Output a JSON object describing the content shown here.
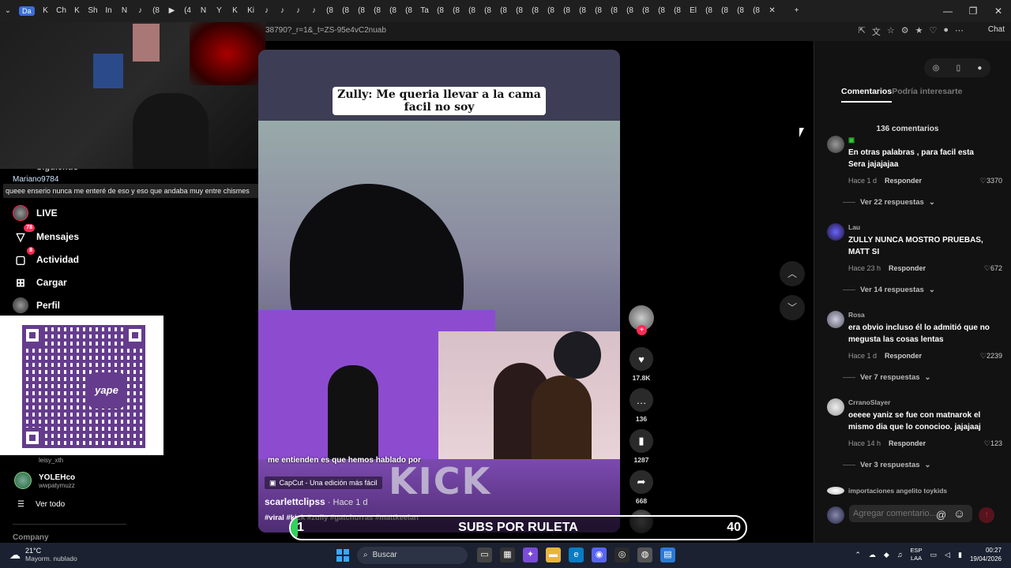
{
  "browser": {
    "active_tab_label": "Da",
    "tab_glyphs": [
      "K",
      "Ch",
      "K",
      "Sh",
      "In",
      "N",
      "♪",
      "(8",
      "▶",
      "(4",
      "N",
      "Y",
      "K",
      "Ki",
      "♪",
      "♪",
      "♪",
      "♪",
      "(8",
      "(8",
      "(8",
      "(8",
      "(8",
      "(8",
      "Ta",
      "(8",
      "(8",
      "(8",
      "(8",
      "(8",
      "(8",
      "(8",
      "(8",
      "(8",
      "(8",
      "(8",
      "(8",
      "(8",
      "(8",
      "(8",
      "(8",
      "El",
      "(8",
      "(8",
      "(8",
      "(8"
    ],
    "url": "38790?_r=1&_t=ZS-95e4vC2nuab",
    "copilot_label": "Chat",
    "window_controls": [
      "—",
      "❐",
      "✕"
    ]
  },
  "stream_overlay": {
    "webcam_username": "Mariano9784",
    "webcam_comment": "queee enserio nunca me enteré de eso y eso que andaba muy entre chismes",
    "subs_label": "SUBS POR RULETA",
    "subs_count": "40",
    "subs_progress_start_number": "1",
    "subs_progress_fraction": 0.015
  },
  "sidebar": {
    "partial_top_label": "Siguiendo",
    "items": [
      {
        "label": "LIVE",
        "icon": "live-avatar-icon",
        "badge": ""
      },
      {
        "label": "Mensajes",
        "icon": "messages-icon",
        "badge": "78"
      },
      {
        "label": "Actividad",
        "icon": "activity-icon",
        "badge": "8"
      },
      {
        "label": "Cargar",
        "icon": "upload-icon",
        "badge": ""
      },
      {
        "label": "Perfil",
        "icon": "profile-icon",
        "badge": ""
      }
    ],
    "qr_brand": "yape",
    "following": [
      {
        "name": "",
        "handle": "leisy_xth"
      },
      {
        "name": "YOLEHco",
        "handle": "wwpatymuzz"
      }
    ],
    "see_all": "Ver todo",
    "footer": "Company"
  },
  "video": {
    "caption_line1": "Zully: Me queria llevar a la cama",
    "caption_line2": "facil no soy",
    "subtitle": "me entienden es que hemos hablado por",
    "overlay_logo": "KICK",
    "capcut_label": "CapCut - Una edición más fácil",
    "author": "scarlettclipss",
    "time": " · Hace 1 d",
    "hashtags": "#viral #kick #zully #gatchurras #mattkeelan"
  },
  "actions": {
    "likes": "17.8K",
    "comments": "136",
    "saves": "1287",
    "shares": "668"
  },
  "comments_panel": {
    "tab_comments": "Comentarios",
    "tab_interest": "Podría interesarte",
    "count_label": "136 comentarios",
    "reply_label": "Responder",
    "comments": [
      {
        "user": "▣",
        "text": "En otras palabras , para facil esta Sera jajajajaa",
        "time": "Hace 1 d",
        "likes": "3370",
        "more": "Ver 22 respuestas"
      },
      {
        "user": "Lau",
        "text": "ZULLY NUNCA MOSTRO PRUEBAS, MATT SI",
        "time": "Hace 23 h",
        "likes": "672",
        "more": "Ver 14 respuestas"
      },
      {
        "user": "Rosa",
        "text": "era obvio incluso él lo admitió que no megusta las cosas lentas",
        "time": "Hace 1 d",
        "likes": "2239",
        "more": "Ver 7 respuestas"
      },
      {
        "user": "CrranoSlayer",
        "text": "oeeee yaniz se fue con matnarok el mismo dia que lo conocioo. jajajaaj",
        "time": "Hace 14 h",
        "likes": "123",
        "more": "Ver 3 respuestas"
      },
      {
        "user": "importaciones angelito toykids",
        "text": "",
        "time": "",
        "likes": "",
        "more": ""
      }
    ],
    "input_placeholder": "Agregar comentario..."
  },
  "taskbar": {
    "temperature": "21°C",
    "weather": "Mayorm. nublado",
    "search_label": "Buscar",
    "lang_line1": "ESP",
    "lang_line2": "LAA",
    "time": "00:27",
    "date": "19/04/2026"
  }
}
